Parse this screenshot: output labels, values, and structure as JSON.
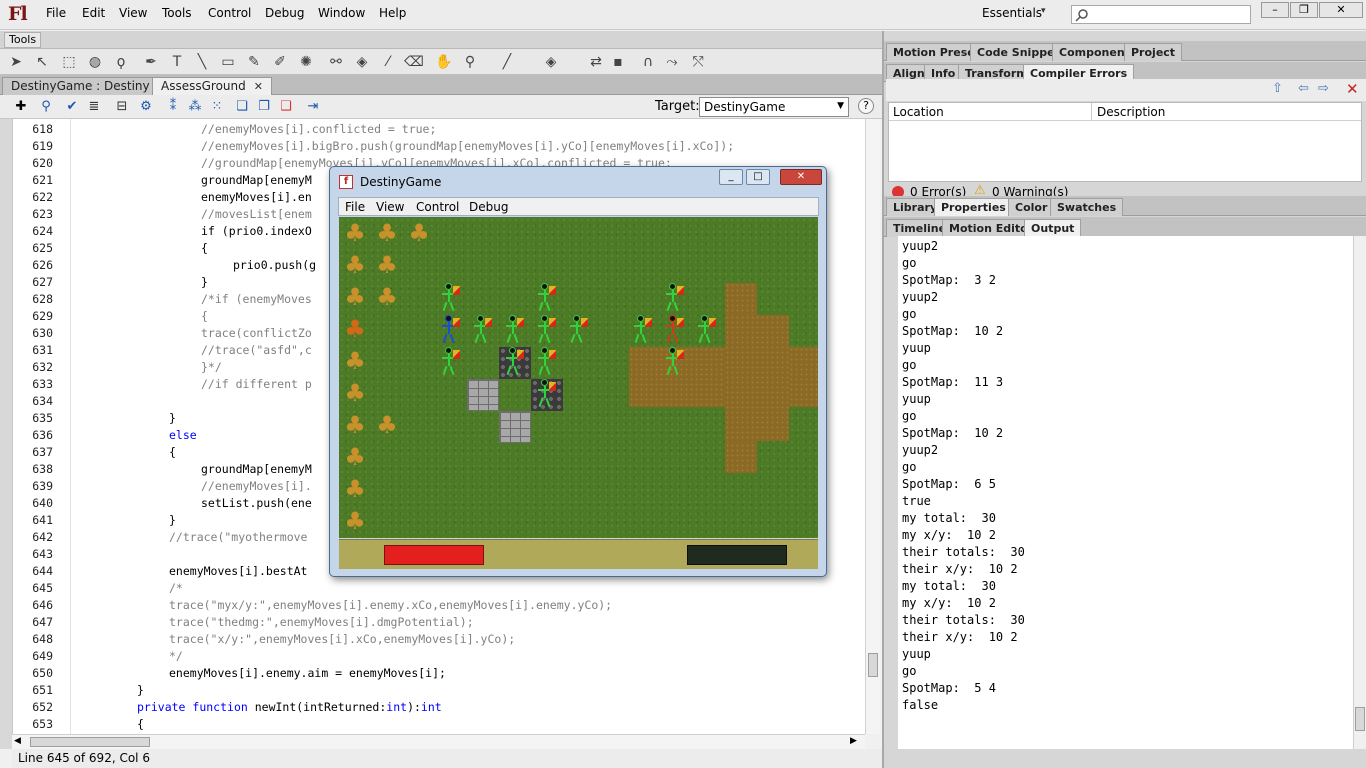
{
  "app": {
    "logo": "Fl",
    "menus": [
      "File",
      "Edit",
      "View",
      "Tools",
      "Control",
      "Debug",
      "Window",
      "Help"
    ],
    "workspace": "Essentials",
    "window_buttons": [
      "–",
      "❐",
      "✕"
    ]
  },
  "tools_panel": {
    "label": "Tools"
  },
  "colors": {
    "stroke_swatch": "#a8a0e0",
    "fill_swatch": "#f4ee9a"
  },
  "doc_tabs": [
    {
      "label": "DestinyGame : Destiny",
      "active": false
    },
    {
      "label": "AssessGround",
      "active": true
    }
  ],
  "script_toolbar": {
    "target_label": "Target:",
    "target_value": "DestinyGame"
  },
  "code": {
    "lines": [
      {
        "n": "618",
        "indent": 16,
        "text": "//enemyMoves[i].conflicted = true;",
        "kind": "comment"
      },
      {
        "n": "619",
        "indent": 16,
        "text": "//enemyMoves[i].bigBro.push(groundMap[enemyMoves[i].yCo][enemyMoves[i].xCo]);",
        "kind": "comment"
      },
      {
        "n": "620",
        "indent": 16,
        "text": "//groundMap[enemyMoves[i].yCo][enemyMoves[i].xCo].conflicted = true;",
        "kind": "comment"
      },
      {
        "n": "621",
        "indent": 16,
        "text": "groundMap[enemyM",
        "kind": "code"
      },
      {
        "n": "622",
        "indent": 16,
        "text": "enemyMoves[i].en",
        "kind": "code"
      },
      {
        "n": "623",
        "indent": 16,
        "text": "//movesList[enem",
        "kind": "comment"
      },
      {
        "n": "624",
        "indent": 16,
        "text": "if (prio0.indexO",
        "kind": "code"
      },
      {
        "n": "625",
        "indent": 16,
        "text": "{",
        "kind": "code"
      },
      {
        "n": "626",
        "indent": 20,
        "text": "prio0.push(g",
        "kind": "code"
      },
      {
        "n": "627",
        "indent": 16,
        "text": "}",
        "kind": "code"
      },
      {
        "n": "628",
        "indent": 16,
        "text": "/*if (enemyMoves",
        "kind": "comment"
      },
      {
        "n": "629",
        "indent": 16,
        "text": "{",
        "kind": "comment"
      },
      {
        "n": "630",
        "indent": 16,
        "text": "trace(conflictZo                                                           i);",
        "kind": "comment"
      },
      {
        "n": "631",
        "indent": 16,
        "text": "//trace(\"asfd\",c                                                            ].my",
        "kind": "comment"
      },
      {
        "n": "632",
        "indent": 16,
        "text": "}*/",
        "kind": "comment"
      },
      {
        "n": "633",
        "indent": 16,
        "text": "//if different p                                                          ween",
        "kind": "comment"
      },
      {
        "n": "634",
        "indent": 0,
        "text": "",
        "kind": "code"
      },
      {
        "n": "635",
        "indent": 12,
        "text": "}",
        "kind": "code"
      },
      {
        "n": "636",
        "indent": 12,
        "text": "else",
        "kind": "keyword"
      },
      {
        "n": "637",
        "indent": 12,
        "text": "{",
        "kind": "code"
      },
      {
        "n": "638",
        "indent": 16,
        "text": "groundMap[enemyM",
        "kind": "code"
      },
      {
        "n": "639",
        "indent": 16,
        "text": "//enemyMoves[i].",
        "kind": "comment"
      },
      {
        "n": "640",
        "indent": 16,
        "text": "setList.push(ene",
        "kind": "code"
      },
      {
        "n": "641",
        "indent": 12,
        "text": "}",
        "kind": "code"
      },
      {
        "n": "642",
        "indent": 12,
        "text": "//trace(\"myothermove",
        "kind": "comment"
      },
      {
        "n": "643",
        "indent": 0,
        "text": "",
        "kind": "code"
      },
      {
        "n": "644",
        "indent": 12,
        "text": "enemyMoves[i].bestAt",
        "kind": "code"
      },
      {
        "n": "645",
        "indent": 12,
        "text": "/*",
        "kind": "comment"
      },
      {
        "n": "646",
        "indent": 12,
        "text": "trace(\"myx/y:\",enemyMoves[i].enemy.xCo,enemyMoves[i].enemy.yCo);",
        "kind": "comment"
      },
      {
        "n": "647",
        "indent": 12,
        "text": "trace(\"thedmg:\",enemyMoves[i].dmgPotential);",
        "kind": "comment"
      },
      {
        "n": "648",
        "indent": 12,
        "text": "trace(\"x/y:\",enemyMoves[i].xCo,enemyMoves[i].yCo);",
        "kind": "comment"
      },
      {
        "n": "649",
        "indent": 12,
        "text": "*/",
        "kind": "comment"
      },
      {
        "n": "650",
        "indent": 12,
        "text": "enemyMoves[i].enemy.aim = enemyMoves[i];",
        "kind": "code"
      },
      {
        "n": "651",
        "indent": 8,
        "text": "}",
        "kind": "code"
      },
      {
        "n": "652",
        "indent": 8,
        "text": "private function newInt(intReturned:int):int",
        "kind": "signature"
      },
      {
        "n": "653",
        "indent": 8,
        "text": "{",
        "kind": "code"
      }
    ]
  },
  "status_bar": "Line 645 of 692, Col 6",
  "right_panel": {
    "top_tabs": [
      "Motion Presets",
      "Code Snippets",
      "Components",
      "Project"
    ],
    "second_tabs": [
      "Align",
      "Info",
      "Transform",
      "Compiler Errors"
    ],
    "error_columns": [
      "Location",
      "Description"
    ],
    "errors_label": "0 Error(s)",
    "warnings_label": "0 Warning(s)",
    "third_tabs": [
      "Library",
      "Properties",
      "Color",
      "Swatches"
    ],
    "fourth_tabs": [
      "Timeline",
      "Motion Editor",
      "Output"
    ]
  },
  "output_lines": [
    "yuup2",
    "go",
    "SpotMap:  3 2",
    "yuup2",
    "go",
    "SpotMap:  10 2",
    "yuup",
    "go",
    "SpotMap:  11 3",
    "yuup",
    "go",
    "SpotMap:  10 2",
    "yuup2",
    "go",
    "SpotMap:  6 5",
    "true",
    "my total:  30",
    "my x/y:  10 2",
    "their totals:  30",
    "their x/y:  10 2",
    "my total:  30",
    "my x/y:  10 2",
    "their totals:  30",
    "their x/y:  10 2",
    "yuup",
    "go",
    "SpotMap:  5 4",
    "false"
  ],
  "game_window": {
    "title": "DestinyGame",
    "menus": [
      "File",
      "View",
      "Control",
      "Debug"
    ],
    "buttons": [
      "_",
      "□",
      "✕"
    ]
  }
}
